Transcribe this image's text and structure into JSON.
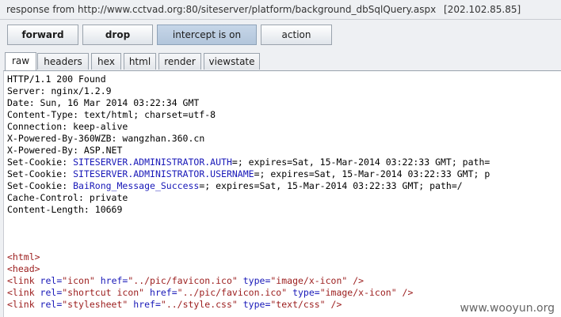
{
  "header": {
    "label": "response from http://www.cctvad.org:80/siteserver/platform/background_dbSqlQuery.aspx",
    "ip": "[202.102.85.85]"
  },
  "toolbar": {
    "forward_label": "forward",
    "drop_label": "drop",
    "intercept_label": "intercept is on",
    "action_label": "action"
  },
  "tabs": [
    {
      "label": "raw",
      "selected": true
    },
    {
      "label": "headers"
    },
    {
      "label": "hex"
    },
    {
      "label": "html"
    },
    {
      "label": "render"
    },
    {
      "label": "viewstate"
    }
  ],
  "response": {
    "status": "HTTP/1.1 200 Found",
    "server": "Server: nginx/1.2.9",
    "date": "Date: Sun, 16 Mar 2014 03:22:34 GMT",
    "content_type": "Content-Type: text/html; charset=utf-8",
    "connection": "Connection: keep-alive",
    "powered_by_1": "X-Powered-By-360WZB: wangzhan.360.cn",
    "powered_by_2": "X-Powered-By: ASP.NET",
    "cookies": [
      {
        "prefix": "Set-Cookie: ",
        "name": "SITESERVER.ADMINISTRATOR.AUTH",
        "rest": "=; expires=Sat, 15-Mar-2014 03:22:33 GMT; path="
      },
      {
        "prefix": "Set-Cookie: ",
        "name": "SITESERVER.ADMINISTRATOR.USERNAME",
        "rest": "=; expires=Sat, 15-Mar-2014 03:22:33 GMT; p"
      },
      {
        "prefix": "Set-Cookie: ",
        "name": "BaiRong_Message_Success",
        "rest": "=; expires=Sat, 15-Mar-2014 03:22:33 GMT; path=/"
      }
    ],
    "cache_control": "Cache-Control: private",
    "content_length": "Content-Length: 10669"
  },
  "html_body": {
    "html_open": "<html>",
    "head_open": "<head>",
    "links": [
      {
        "open": "<link",
        "rel_attr": " rel=",
        "rel": "\"icon\"",
        "href_attr": " href=",
        "href": "\"../pic/favicon.ico\"",
        "type_attr": " type=",
        "type": "\"image/x-icon\"",
        "close": " />"
      },
      {
        "open": "<link",
        "rel_attr": " rel=",
        "rel": "\"shortcut icon\"",
        "href_attr": " href=",
        "href": "\"../pic/favicon.ico\"",
        "type_attr": " type=",
        "type": "\"image/x-icon\"",
        "close": " />"
      },
      {
        "open": "<link",
        "rel_attr": " rel=",
        "rel": "\"stylesheet\"",
        "href_attr": " href=",
        "href": "\"../style.css\"",
        "type_attr": " type=",
        "type": "\"text/css\"",
        "close": " />"
      }
    ]
  },
  "watermark": "www.wooyun.org"
}
